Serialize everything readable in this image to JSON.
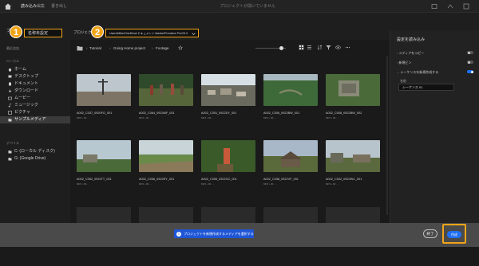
{
  "topbar": {
    "tabs": [
      "読み込み",
      "編集",
      "書き出し"
    ],
    "status": "プロジェクトが開いていません"
  },
  "row2": {
    "project_name": "名称未設定",
    "location_label": "プロジェクト",
    "location_value": "Users\\Mike\\OneDrive\\ドキュメント\\Adobe\\Premiere Pro\\23.0",
    "badge1": "1",
    "badge2": "2"
  },
  "sidebar": {
    "recent_title": "最近追加",
    "local_title": "ローカル",
    "items": [
      "ホーム",
      "デスクトップ",
      "ドキュメント",
      "ダウンロード",
      "ムービー",
      "ミュージック",
      "ピクチャ",
      "サンプルメディア"
    ],
    "devices_title": "デバイス",
    "devices": [
      "C: (ローカル ディスク)",
      "G: (Google Drive)"
    ]
  },
  "main": {
    "breadcrumb": [
      "Tutorial",
      "Going Home project",
      "Footage"
    ],
    "clips": [
      {
        "name": "A002_C037_0920FG_001",
        "meta": "MP4 • 00:..."
      },
      {
        "name": "A002_C064_0923MF_001",
        "meta": "MP4 • 00:..."
      },
      {
        "name": "A002_C051_0922DY_001",
        "meta": "MP4 • 00:..."
      },
      {
        "name": "A002_C006_0922BW_001",
        "meta": "MP4 • 00:..."
      },
      {
        "name": "A002_C008_0922BW_002",
        "meta": "MP4 • 00:..."
      },
      {
        "name": "A002_C052_0922TT_001",
        "meta": "MP4 • 00:..."
      },
      {
        "name": "A002_C036_0922RY_001",
        "meta": "MP4 • 00:..."
      },
      {
        "name": "A002_C006_0922GC_001",
        "meta": "MP4 • 00:..."
      },
      {
        "name": "A002_C038_0922VF_001",
        "meta": "MP4 • 00:..."
      },
      {
        "name": "A002_C002_0922WC_001",
        "meta": "MP4 • 00:..."
      }
    ]
  },
  "rpanel": {
    "title": "設定を読み込み",
    "opt1": "メディアをコピー",
    "opt2": "新規ビン",
    "opt3": "シーケンスを新規作成する",
    "name_label": "名前",
    "name_value": "シーケンス 01"
  },
  "bottom": {
    "notice": "プロジェクトを新規作成するメディアを選択する",
    "close": "終了",
    "create": "作成"
  },
  "colors": {
    "accent": "#1f6ff5",
    "highlight": "#f0a418"
  }
}
